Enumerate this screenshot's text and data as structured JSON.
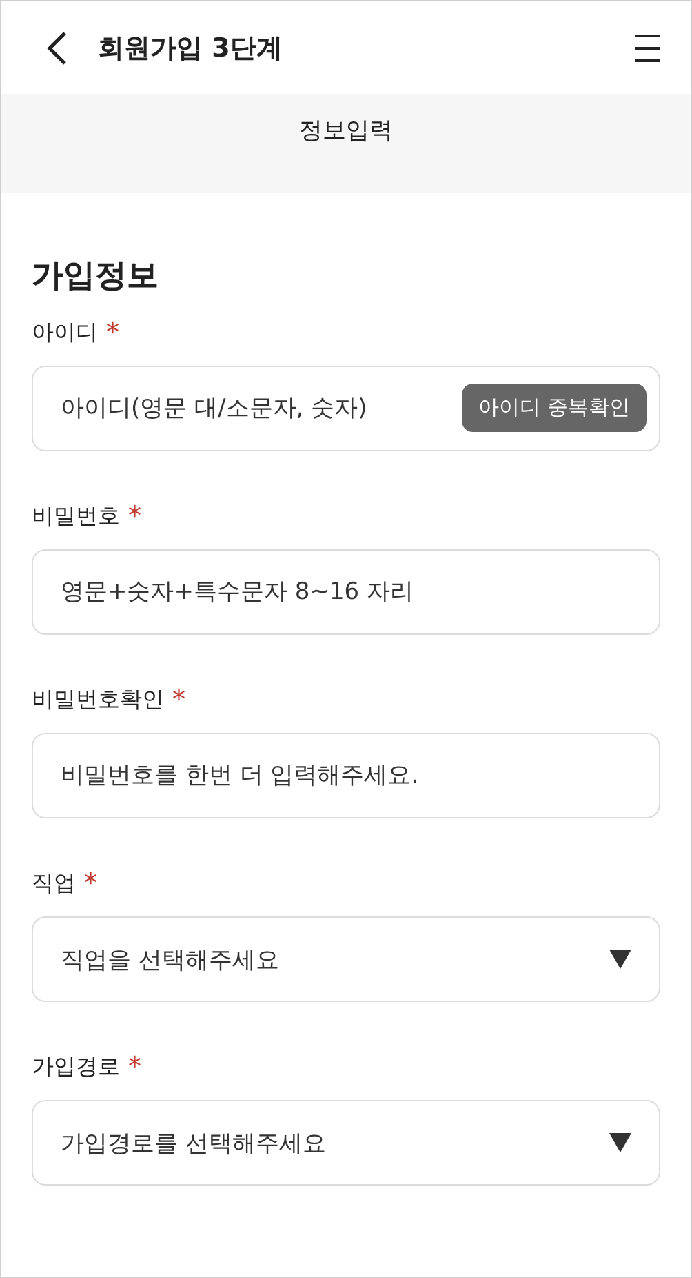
{
  "header": {
    "title": "회원가입 3단계"
  },
  "step_band": {
    "title": "정보입력"
  },
  "section": {
    "title": "가입정보"
  },
  "fields": [
    {
      "kind": "text",
      "label": "아이디",
      "required_mark": "*",
      "placeholder": "아이디(영문 대/소문자, 숫자)",
      "button": "아이디 중복확인"
    },
    {
      "kind": "text",
      "label": "비밀번호",
      "required_mark": "*",
      "placeholder": "영문+숫자+특수문자 8~16 자리"
    },
    {
      "kind": "text",
      "label": "비밀번호확인",
      "required_mark": "*",
      "placeholder": "비밀번호를 한번 더 입력해주세요."
    },
    {
      "kind": "select",
      "label": "직업",
      "required_mark": "*",
      "placeholder": "직업을 선택해주세요"
    },
    {
      "kind": "select",
      "label": "가입경로",
      "required_mark": "*",
      "placeholder": "가입경로를 선택해주세요"
    }
  ]
}
